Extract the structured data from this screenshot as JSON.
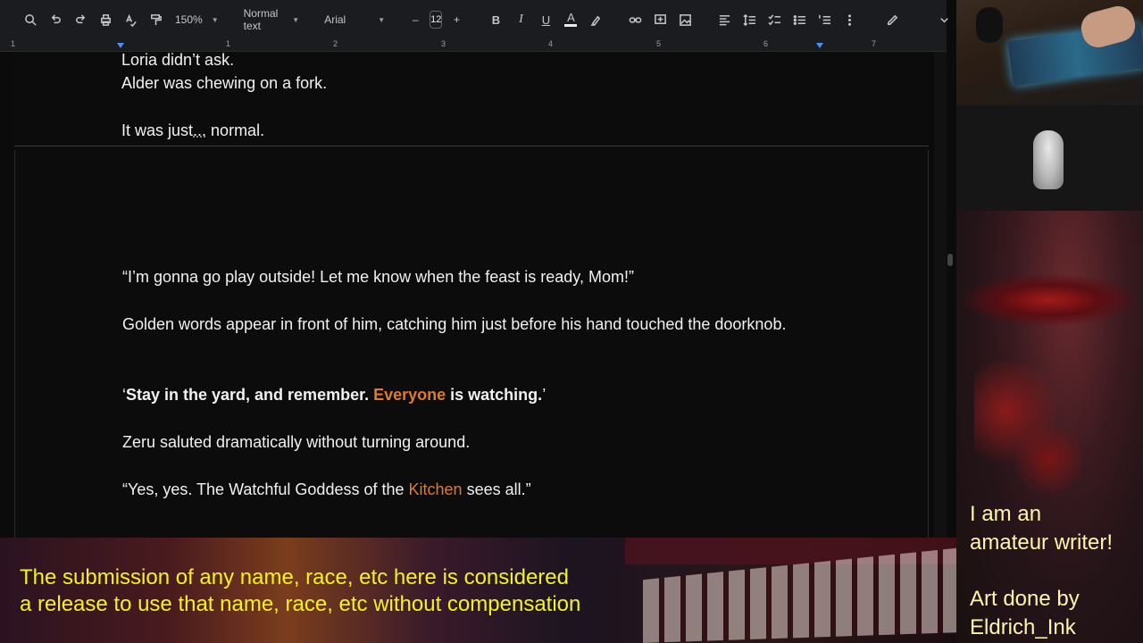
{
  "toolbar": {
    "zoom": "150%",
    "style": "Normal text",
    "font": "Arial",
    "font_size": "12",
    "minus": "–",
    "plus": "+",
    "bold": "B",
    "italic": "I",
    "underline": "U",
    "text_color": "A"
  },
  "ruler": {
    "numbers": [
      "1",
      "1",
      "2",
      "3",
      "4",
      "5",
      "6",
      "7"
    ]
  },
  "document": {
    "page1": [
      "Loria didn’t ask.",
      "Alder was chewing on a fork.",
      "It was just",
      "...",
      " normal."
    ],
    "page2": {
      "p1": "“I’m gonna go play outside! Let me know when the feast is ready, Mom!”",
      "p2": "Golden words appear in front of him, catching him just before his hand touched the doorknob.",
      "p3_open": "‘",
      "p3_bold1": "Stay in the yard, and remember. ",
      "p3_orange": "Everyone",
      "p3_bold2": " is watching.",
      "p3_close": "’",
      "p4": "Zeru saluted dramatically without turning around.",
      "p5_a": "“Yes, yes. The Watchful Goddess of the ",
      "p5_orange": "Kitchen",
      "p5_b": " sees all.”"
    }
  },
  "panel": {
    "line1": "I am an",
    "line2": "amateur writer!",
    "line3": "Art done by",
    "line4": "Eldrich_Ink"
  },
  "banner": {
    "line1": "The submission of any name, race, etc here is considered",
    "line2": "a release to use that name, race, etc without compensation"
  },
  "colors": {
    "accent_orange": "#e07b2e",
    "banner_yellow": "#f3f31e",
    "panel_text": "#fff4b0"
  }
}
